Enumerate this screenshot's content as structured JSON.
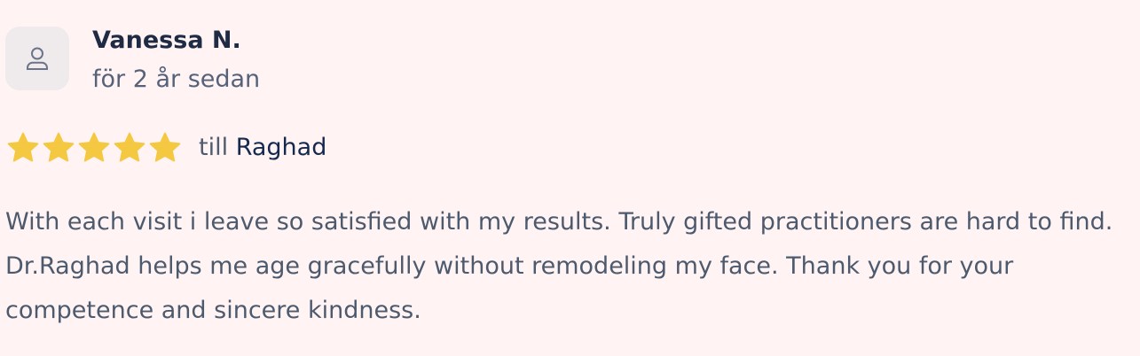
{
  "review": {
    "reviewer_name": "Vanessa N.",
    "date": "för 2 år sedan",
    "rating": 5,
    "rating_max": 5,
    "target_prefix": "till",
    "provider_name": "Raghad",
    "text": "With each visit i leave so satisfied with my results. Truly gifted practitioners are hard to find. Dr.Raghad helps me age gracefully without remodeling my face. Thank you for your competence and sincere kindness."
  },
  "icons": {
    "avatar": "user-icon",
    "rating": "star-icon"
  },
  "colors": {
    "background": "#fff4f3",
    "star": "#f5c842",
    "name": "#1f2a44",
    "provider": "#14294d",
    "text": "#4d5a6e"
  }
}
